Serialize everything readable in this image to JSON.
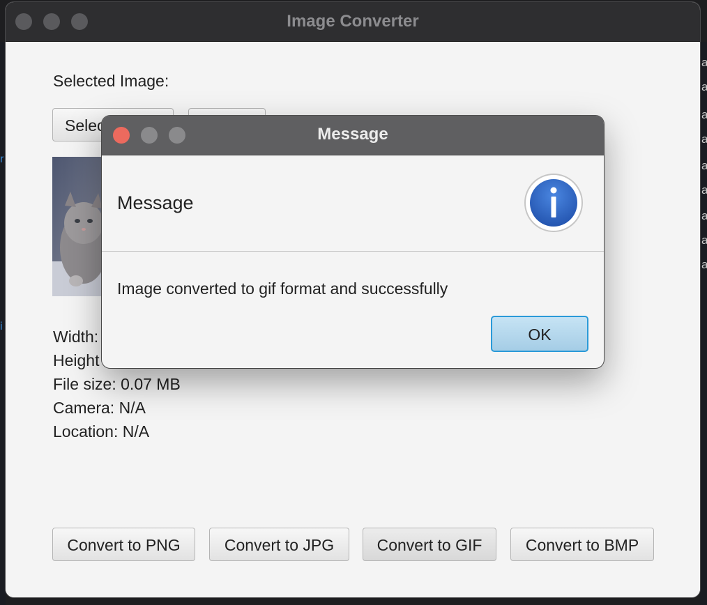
{
  "main_window": {
    "title": "Image Converter",
    "selected_image_label": "Selected Image:",
    "select_button_label": "Selec",
    "second_button_label": "",
    "info": {
      "width": "Width:",
      "height": "Height",
      "file_size": "File size: 0.07 MB",
      "camera": "Camera: N/A",
      "location": "Location: N/A"
    },
    "convert_buttons": {
      "png": "Convert to PNG",
      "jpg": "Convert to JPG",
      "gif": "Convert to GIF",
      "bmp": "Convert to BMP"
    }
  },
  "dialog": {
    "title": "Message",
    "header_text": "Message",
    "icon": "info-icon",
    "message": "Image converted to gif format and successfully",
    "ok_label": "OK"
  },
  "colors": {
    "close_button": "#ec6a5e",
    "ok_border": "#2a9ad8",
    "info_icon_blue": "#2f67c9"
  }
}
